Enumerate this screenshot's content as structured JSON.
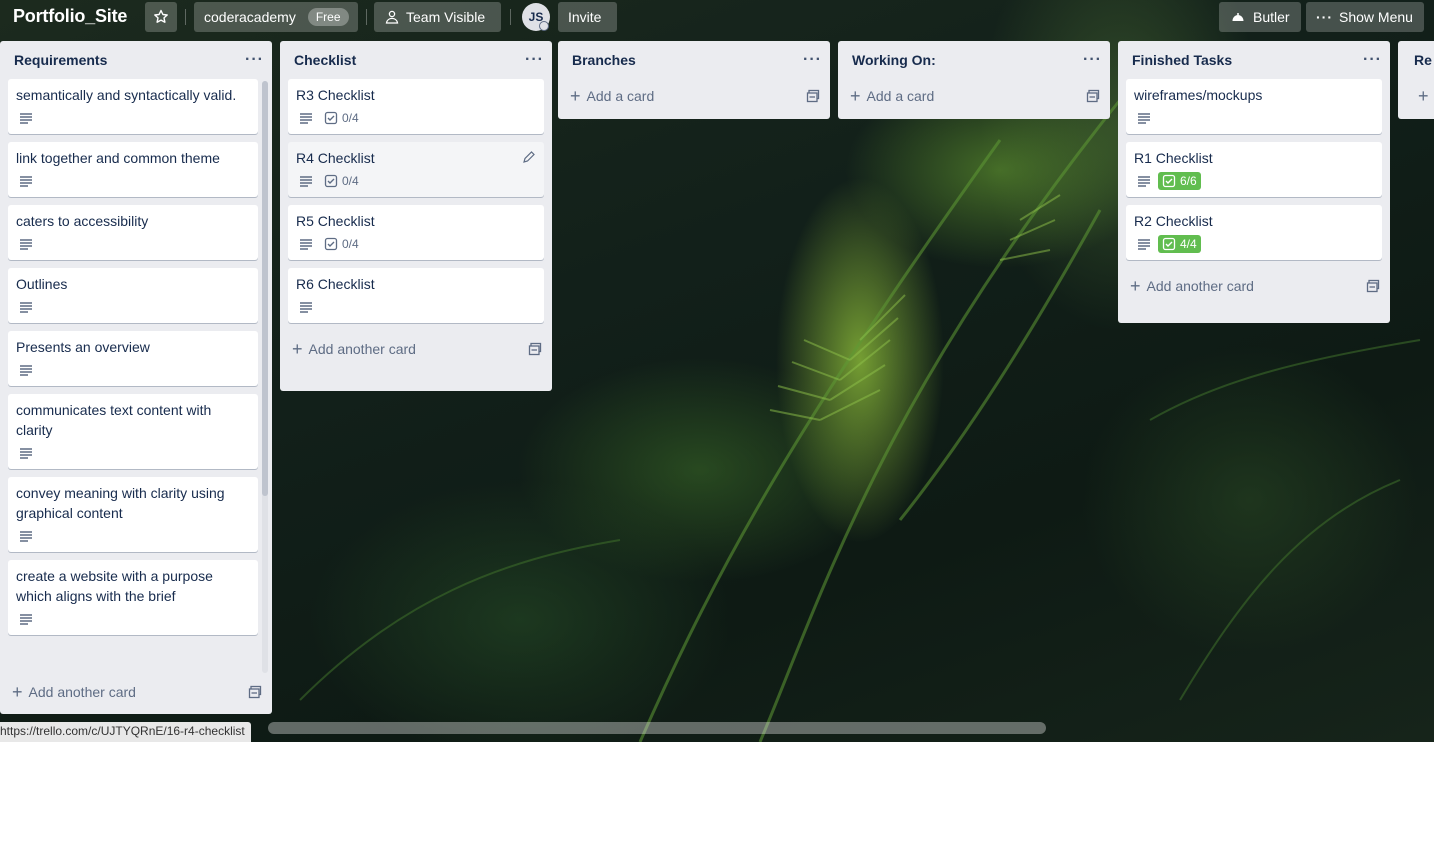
{
  "header": {
    "board_name": "Portfolio_Site",
    "workspace": "coderacademy",
    "plan_badge": "Free",
    "visibility": "Team Visible",
    "avatar_initials": "JS",
    "invite": "Invite",
    "butler": "Butler",
    "show_menu": "Show Menu"
  },
  "lists": {
    "requirements": {
      "title": "Requirements",
      "cards": [
        "semantically and syntactically valid.",
        "link together and common theme",
        "caters to accessibility",
        "Outlines",
        "Presents an overview",
        "communicates text content with clarity",
        "convey meaning with clarity using graphical content",
        "create a website with a purpose which aligns with the brief"
      ],
      "add": "Add another card"
    },
    "checklist": {
      "title": "Checklist",
      "cards": [
        {
          "title": "R3 Checklist",
          "progress": "0/4"
        },
        {
          "title": "R4 Checklist",
          "progress": "0/4"
        },
        {
          "title": "R5 Checklist",
          "progress": "0/4"
        },
        {
          "title": "R6 Checklist"
        }
      ],
      "add": "Add another card"
    },
    "branches": {
      "title": "Branches",
      "add": "Add a card"
    },
    "working_on": {
      "title": "Working On:",
      "add": "Add a card"
    },
    "finished": {
      "title": "Finished Tasks",
      "cards": [
        {
          "title": "wireframes/mockups"
        },
        {
          "title": "R1 Checklist",
          "progress": "6/6"
        },
        {
          "title": "R2 Checklist",
          "progress": "4/4"
        }
      ],
      "add": "Add another card"
    },
    "partial": {
      "title": "Re"
    }
  },
  "status_url": "https://trello.com/c/UJTYQRnE/16-r4-checklist",
  "colors": {
    "accent_green": "#61bd4f",
    "list_bg": "#ebecf0"
  },
  "icons": [
    "star-icon",
    "team-icon",
    "butler-icon",
    "ellipsis-icon",
    "description-icon",
    "checklist-icon",
    "plus-icon",
    "template-icon",
    "pencil-icon"
  ]
}
